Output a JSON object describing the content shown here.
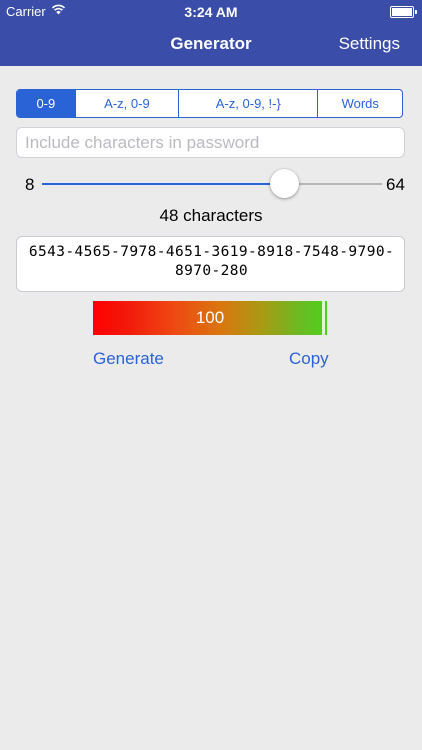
{
  "status_bar": {
    "carrier": "Carrier",
    "time": "3:24 AM"
  },
  "nav": {
    "title": "Generator",
    "settings_label": "Settings"
  },
  "segments": [
    {
      "label": "0-9",
      "active": true
    },
    {
      "label": "A-z, 0-9",
      "active": false
    },
    {
      "label": "A-z, 0-9, !-}",
      "active": false
    },
    {
      "label": "Words",
      "active": false
    }
  ],
  "charset_input": {
    "placeholder": "Include characters in password",
    "value": ""
  },
  "slider": {
    "min_label": "8",
    "max_label": "64",
    "min": 8,
    "max": 64,
    "value": 48
  },
  "length_label": "48 characters",
  "password": "6543-4565-7978-4651-3619-8918-7548-9790-8970-280",
  "strength": {
    "value_label": "100",
    "level": 1.0
  },
  "actions": {
    "generate_label": "Generate",
    "copy_label": "Copy"
  },
  "colors": {
    "nav_bg": "#3a4da8",
    "accent": "#2a63d6",
    "background": "#ebebeb"
  }
}
